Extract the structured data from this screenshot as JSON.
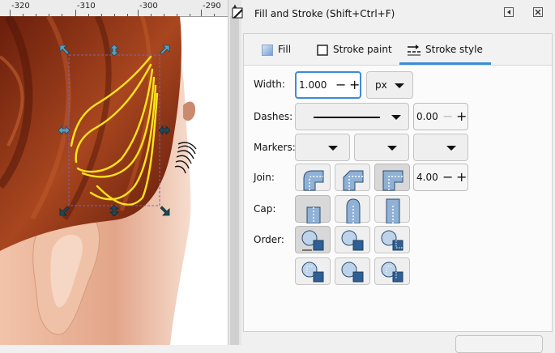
{
  "ruler": {
    "labels": [
      "-320",
      "-310",
      "-300",
      "-290"
    ]
  },
  "dialog": {
    "title": "Fill and Stroke (Shift+Ctrl+F)",
    "minimize_icon": "dock-icon",
    "close_icon": "close-icon"
  },
  "tabs": [
    {
      "label": "Fill",
      "icon": "fill-icon"
    },
    {
      "label": "Stroke paint",
      "icon": "stroke-paint-icon"
    },
    {
      "label": "Stroke style",
      "icon": "stroke-style-icon",
      "active": true
    }
  ],
  "stroke_style": {
    "width_label": "Width:",
    "width_value": "1.000",
    "unit": "px",
    "dashes_label": "Dashes:",
    "dash_offset": "0.00",
    "markers_label": "Markers:",
    "join_label": "Join:",
    "miter_limit": "4.00",
    "cap_label": "Cap:",
    "order_label": "Order:"
  },
  "colors": {
    "accent": "#3c8bd9",
    "selection_path": "#ffe31a",
    "hair": "#8a2d14",
    "skin": "#e0a98c"
  }
}
